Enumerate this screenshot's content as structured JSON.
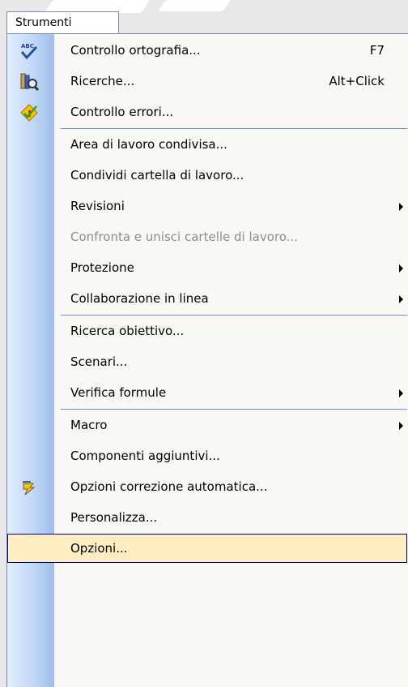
{
  "menu": {
    "title": "Strumenti",
    "items": [
      {
        "label": "Controllo ortografia...",
        "shortcut": "F7",
        "icon": "spellcheck-icon"
      },
      {
        "label": "Ricerche...",
        "shortcut": "Alt+Click",
        "icon": "research-icon"
      },
      {
        "label": "Controllo errori...",
        "icon": "error-check-icon"
      },
      {
        "label": "Area di lavoro condivisa..."
      },
      {
        "label": "Condividi cartella di lavoro..."
      },
      {
        "label": "Revisioni",
        "submenu": true
      },
      {
        "label": "Confronta e unisci cartelle di lavoro...",
        "disabled": true
      },
      {
        "label": "Protezione",
        "submenu": true
      },
      {
        "label": "Collaborazione in linea",
        "submenu": true
      },
      {
        "label": "Ricerca obiettivo..."
      },
      {
        "label": "Scenari..."
      },
      {
        "label": "Verifica formule",
        "submenu": true
      },
      {
        "label": "Macro",
        "submenu": true
      },
      {
        "label": "Componenti aggiuntivi..."
      },
      {
        "label": "Opzioni correzione automatica...",
        "icon": "autocorrect-icon"
      },
      {
        "label": "Personalizza..."
      },
      {
        "label": "Opzioni...",
        "highlighted": true
      }
    ]
  },
  "colors": {
    "highlight_bg": "#ffeec2",
    "highlight_border": "#000080",
    "separator": "#6a8cc6",
    "disabled_text": "#8d8d8d"
  }
}
